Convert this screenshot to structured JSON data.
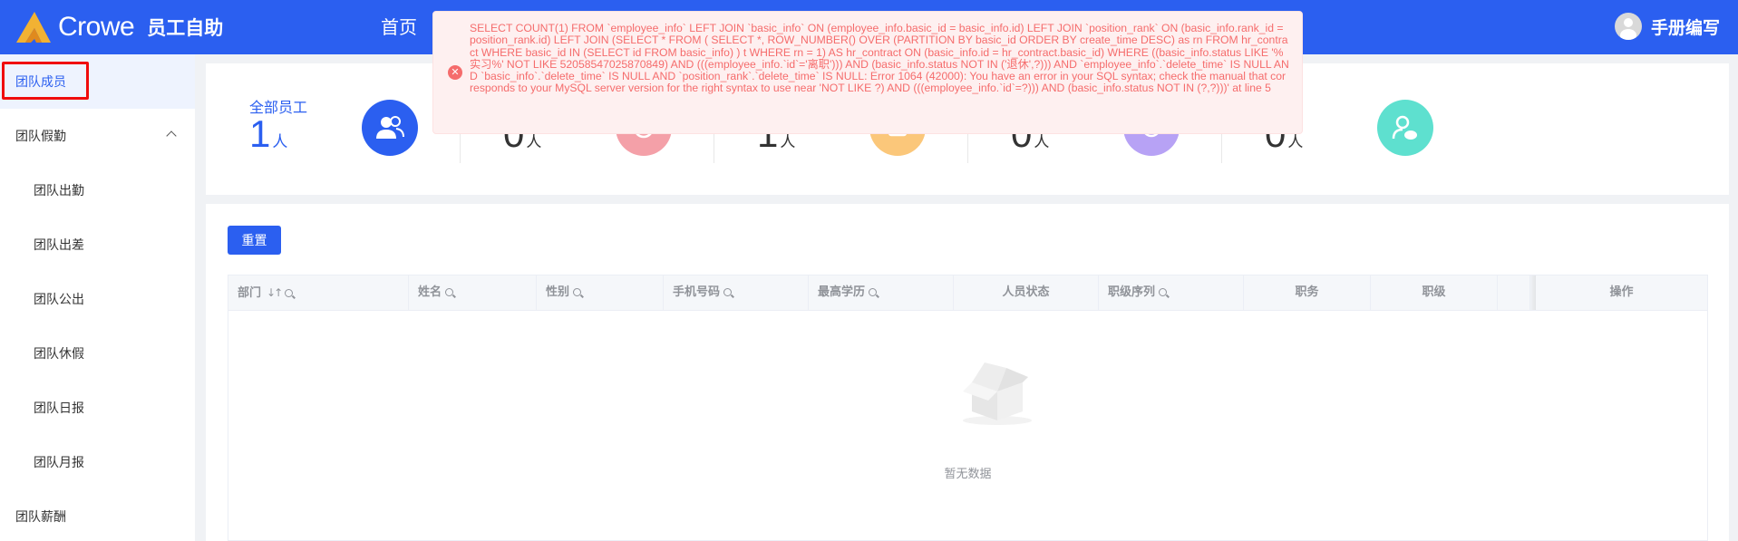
{
  "header": {
    "logo_text": "Crowe",
    "app_name": "员工自助",
    "nav_home": "首页",
    "user_name": "手册编写"
  },
  "sidebar": {
    "items": [
      {
        "label": "团队成员",
        "level": "top",
        "active": true
      },
      {
        "label": "团队假勤",
        "level": "top",
        "expanded": true
      },
      {
        "label": "团队出勤",
        "level": "sub"
      },
      {
        "label": "团队出差",
        "level": "sub"
      },
      {
        "label": "团队公出",
        "level": "sub"
      },
      {
        "label": "团队休假",
        "level": "sub"
      },
      {
        "label": "团队日报",
        "level": "sub"
      },
      {
        "label": "团队月报",
        "level": "sub"
      },
      {
        "label": "团队薪酬",
        "level": "top"
      }
    ]
  },
  "stats": [
    {
      "label": "全部员工",
      "value": "1",
      "unit": "人",
      "icon": "users-icon",
      "color": "#2b5ff0"
    },
    {
      "label": "",
      "value": "0",
      "unit": "人",
      "icon": "check-icon",
      "color": "#f4a0a8"
    },
    {
      "label": "",
      "value": "1",
      "unit": "人",
      "icon": "calendar-icon",
      "color": "#fbc77a"
    },
    {
      "label": "",
      "value": "0",
      "unit": "人",
      "icon": "clock-user-icon",
      "color": "#b7a2f5"
    },
    {
      "label": "",
      "value": "0",
      "unit": "人",
      "icon": "user-cloud-icon",
      "color": "#5ee0cf"
    }
  ],
  "error": {
    "message": "SELECT COUNT(1) FROM `employee_info` LEFT JOIN `basic_info` ON (employee_info.basic_id = basic_info.id) LEFT JOIN `position_rank` ON (basic_info.rank_id = position_rank.id) LEFT JOIN (SELECT * FROM ( SELECT *, ROW_NUMBER() OVER (PARTITION BY basic_id ORDER BY create_time DESC) as rn FROM hr_contract WHERE basic_id IN (SELECT id FROM basic_info) ) t WHERE rn = 1) AS hr_contract ON (basic_info.id = hr_contract.basic_id) WHERE ((basic_info.status LIKE '%实习%' NOT LIKE 52058547025870849) AND (((employee_info.`id`='离职'))) AND (basic_info.status NOT IN ('退休',?))) AND `employee_info`.`delete_time` IS NULL AND `basic_info`.`delete_time` IS NULL AND `position_rank`.`delete_time` IS NULL: Error 1064 (42000): You have an error in your SQL syntax; check the manual that corresponds to your MySQL server version for the right syntax to use near 'NOT LIKE ?) AND (((employee_info.`id`=?))) AND (basic_info.status NOT IN (?,?)))' at line 5"
  },
  "toolbar": {
    "reset_label": "重置"
  },
  "table": {
    "columns": [
      "部门",
      "姓名",
      "性别",
      "手机号码",
      "最高学历",
      "人员状态",
      "职级序列",
      "职务",
      "职级",
      "",
      "操作"
    ],
    "empty_text": "暂无数据"
  }
}
